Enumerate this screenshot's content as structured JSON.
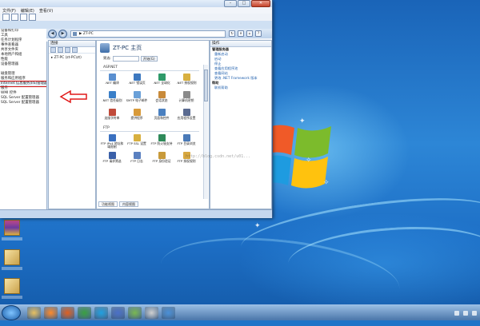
{
  "window": {
    "menu": [
      "文件(F)",
      "编辑(E)",
      "查看(V)"
    ],
    "tree_items": [
      "设备和打印",
      "工具",
      "任务计划程序",
      "事件查看器",
      "共享文件夹",
      "本地用户和组",
      "性能",
      "设备管理器",
      "",
      "磁盘管理",
      "服务和应用程序",
      "Internet 信息服务(IIS)管理器",
      "服务",
      "WMI 控件",
      "SQL Server 配置管理器",
      "SQL Server 配置管理器"
    ],
    "highlighted_index": 11
  },
  "iis": {
    "address": "ZT-PC",
    "nav_separator": "▶",
    "connections_title": "连接",
    "connection_node": "ZT-PC (zt-PC\\zt)",
    "home_title": "ZT-PC 主页",
    "filter_label": "筛选:",
    "filter_go": "开始(G)",
    "sections": [
      {
        "name": "ASP.NET",
        "items": [
          {
            "label": ".NET 编译",
            "color": "#5a8fd0"
          },
          {
            "label": ".NET 错误页",
            "color": "#3c78c0"
          },
          {
            "label": ".NET 全球化",
            "color": "#2f9a6a"
          },
          {
            "label": ".NET 授权规则",
            "color": "#d8b040"
          },
          {
            "label": ".NET 信任级别",
            "color": "#3a7fc8"
          },
          {
            "label": "SMTP 电子邮件",
            "color": "#6aa0d8"
          },
          {
            "label": "会话状态",
            "color": "#c88a3a"
          },
          {
            "label": "计算机密钥",
            "color": "#8a8a8a"
          },
          {
            "label": "连接字符串",
            "color": "#c04a3a"
          },
          {
            "label": "提供程序",
            "color": "#d89a3a"
          },
          {
            "label": "页面和控件",
            "color": "#4a80c0"
          },
          {
            "label": "应用程序设置",
            "color": "#5a6a90"
          }
        ]
      },
      {
        "name": "FTP",
        "items": [
          {
            "label": "FTP IPv4 地址和域限制",
            "color": "#3a70c0"
          },
          {
            "label": "FTP SSL 设置",
            "color": "#d8b040"
          },
          {
            "label": "FTP 防火墙支持",
            "color": "#2f8a5a"
          },
          {
            "label": "FTP 目录浏览",
            "color": "#4a7ab8"
          },
          {
            "label": "FTP 请求筛选",
            "color": "#3a60a8"
          },
          {
            "label": "FTP 日志",
            "color": "#5a80c0"
          },
          {
            "label": "FTP 身份验证",
            "color": "#c89a3a"
          },
          {
            "label": "FTP 授权规则",
            "color": "#d8a840"
          }
        ]
      }
    ],
    "view_tabs": [
      "功能视图",
      "内容视图"
    ],
    "actions_title": "操作",
    "actions": [
      {
        "text": "管理服务器",
        "header": true
      },
      {
        "text": "重新启动",
        "header": false
      },
      {
        "text": "启动",
        "header": false
      },
      {
        "text": "停止",
        "header": false
      },
      {
        "text": "查看应用程序池",
        "header": false
      },
      {
        "text": "查看网站",
        "header": false
      },
      {
        "text": "更改 .NET Framework 版本",
        "header": false
      },
      {
        "text": "帮助",
        "header": true
      },
      {
        "text": "联机帮助",
        "header": false
      }
    ],
    "watermark": "http://blog.csdn.net/u01..."
  },
  "taskbar": {
    "icons": [
      "explorer",
      "media-player",
      "firefox",
      "chrome",
      "qq",
      "baidu",
      "app",
      "photo",
      "network"
    ],
    "colors": [
      "#e8c060",
      "#ff8a2a",
      "#e06020",
      "#3aa040",
      "#20a0e0",
      "#4a70c8",
      "#7ab850",
      "#d0d0d0",
      "#4a90d8"
    ]
  },
  "desktop": {
    "icon_count": 3
  }
}
